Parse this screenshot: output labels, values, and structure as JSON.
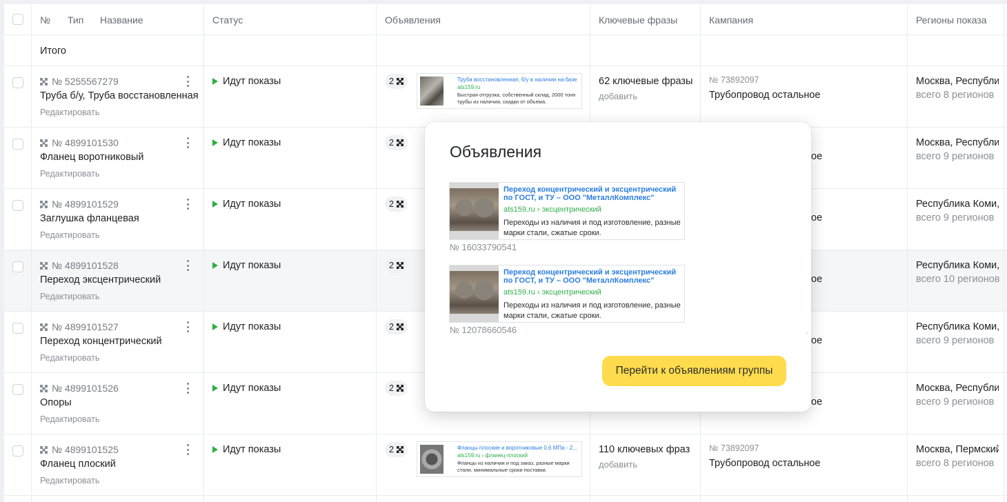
{
  "header": {
    "num": "№",
    "type": "Тип",
    "name": "Название",
    "status": "Статус",
    "ads": "Объявления",
    "keywords": "Ключевые фразы",
    "campaign": "Кампания",
    "regions": "Регионы показа"
  },
  "total_label": "Итого",
  "edit_label": "Редактировать",
  "rows": [
    {
      "num": "№ 5255567279",
      "name": "Труба б/у, Труба восстановленная",
      "status": "Идут показы",
      "ads_count": "2",
      "ad": {
        "title": "Труба восстановленная, б/у в наличии на базе",
        "url": "ats159.ru",
        "desc": "Быстрая отгрузка, собственный склад, 2000 тонн трубы из наличия, скидки от объема."
      },
      "keywords": "62 ключевые фразы",
      "kw_add": "добавить",
      "camp_num": "№ 73892097",
      "camp_name": "Трубопровод остальное",
      "region": "Москва, Республика",
      "region_count": "всего 8 регионов"
    },
    {
      "num": "№ 4899101530",
      "name": "Фланец воротниковый",
      "status": "Идут показы",
      "ads_count": "2",
      "camp_name_tail": "ое",
      "region": "Москва, Республика",
      "region_count": "всего 9 регионов"
    },
    {
      "num": "№ 4899101529",
      "name": "Заглушка фланцевая",
      "status": "Идут показы",
      "ads_count": "2",
      "camp_name_tail": "ое",
      "region": "Республика Коми,",
      "region_count": "всего 9 регионов"
    },
    {
      "num": "№ 4899101528",
      "name": "Переход эксцентрический",
      "status": "Идут показы",
      "ads_count": "2",
      "camp_name_tail": "ое",
      "region": "Республика Коми,",
      "region_count": "всего 10 регионов"
    },
    {
      "num": "№ 4899101527",
      "name": "Переход концентрический",
      "status": "Идут показы",
      "ads_count": "2",
      "camp_name_tail": "ое",
      "region": "Республика Коми,",
      "region_count": "всего 9 регионов"
    },
    {
      "num": "№ 4899101526",
      "name": "Опоры",
      "status": "Идут показы",
      "ads_count": "2",
      "camp_name_tail": "ое",
      "region": "Москва, Республика",
      "region_count": "всего 9 регионов"
    },
    {
      "num": "№ 4899101525",
      "name": "Фланец плоский",
      "status": "Идут показы",
      "ads_count": "2",
      "ad": {
        "title": "Фланцы плоские и воротниковые 0,6 МПа - 2...",
        "url": "ats159.ru › фланец-плоский",
        "desc": "Фланцы из наличия и под заказ, разные марки стали, минимальные сроки поставки."
      },
      "keywords": "110 ключевых фраз",
      "kw_add": "добавить",
      "camp_num": "№ 73892097",
      "camp_name": "Трубопровод остальное",
      "region": "Москва, Пермский",
      "region_count": "всего 8 регионов"
    }
  ],
  "popup": {
    "title": "Объявления",
    "ads": [
      {
        "title": "Переход концентрический и эксцентрический по ГОСТ, и ТУ – ООО \"МеталлКомплекс\"",
        "url": "ats159.ru › эксцентрический",
        "desc": "Переходы из наличия и под изготовление, разные марки стали, сжатые сроки.",
        "num": "№ 16033790541"
      },
      {
        "title": "Переход концентрический и эксцентрический по ГОСТ, и ТУ – ООО \"МеталлКомплекс\"",
        "url": "ats159.ru › эксцентрический",
        "desc": "Переходы из наличия и под изготовление, разные марки стали, сжатые сроки.",
        "num": "№ 12078660546"
      }
    ],
    "button": "Перейти к объявлениям группы"
  },
  "colors": {
    "accent_button": "#ffdc4d",
    "link": "#2a7de1",
    "url_green": "#2eae48",
    "status_play": "#2eae48"
  }
}
